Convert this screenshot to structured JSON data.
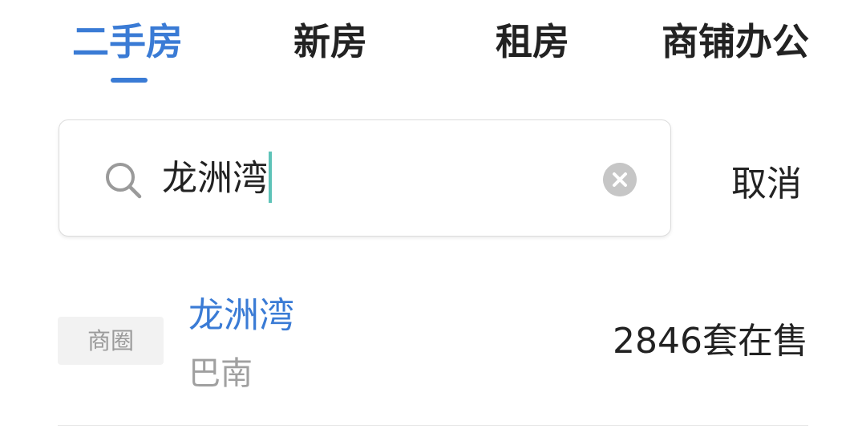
{
  "tabs": [
    {
      "label": "二手房",
      "active": true
    },
    {
      "label": "新房",
      "active": false
    },
    {
      "label": "租房",
      "active": false
    },
    {
      "label": "商铺办公",
      "active": false
    }
  ],
  "search": {
    "value": "龙洲湾",
    "icon": "search-icon",
    "clear_icon": "clear-icon",
    "cancel_label": "取消"
  },
  "results": [
    {
      "tag": "商圈",
      "title": "龙洲湾",
      "subtitle": "巴南",
      "count": "2846套在售"
    }
  ],
  "colors": {
    "accent": "#3a7bd5",
    "caret": "#5ec3b8",
    "muted_text": "#a0a0a0",
    "tag_bg": "#f2f2f2",
    "clear_icon_bg": "#c6c6c6"
  }
}
